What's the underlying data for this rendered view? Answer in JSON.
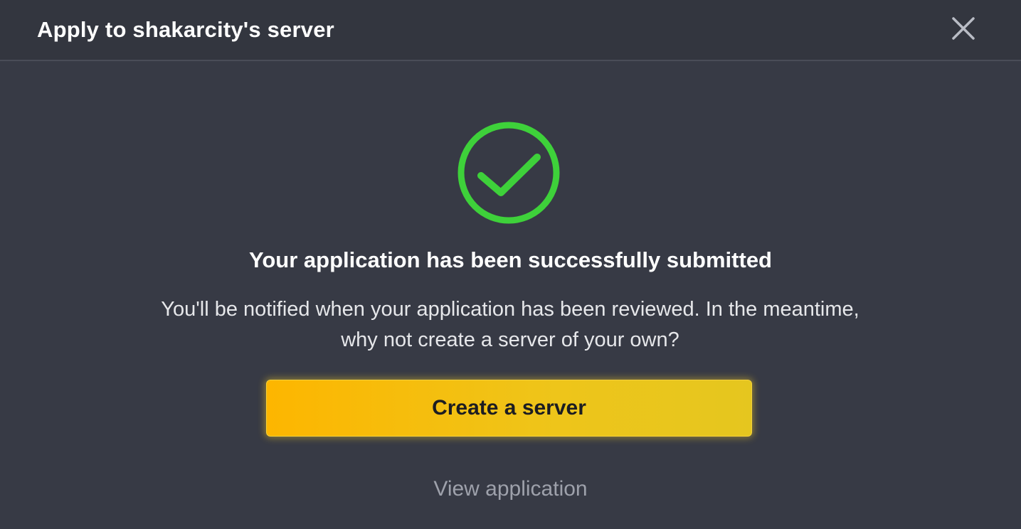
{
  "dialog": {
    "title": "Apply to shakarcity's server",
    "close_icon": "close-icon"
  },
  "status": {
    "icon": "check-circle-icon",
    "color": "#3ed13a",
    "headline": "Your application has been successfully submitted",
    "message": "You'll be notified when your application has been reviewed. In the meantime, why not create a server of your own?"
  },
  "actions": {
    "create_label": "Create a server",
    "view_label": "View application",
    "accent": "#fdb600"
  }
}
